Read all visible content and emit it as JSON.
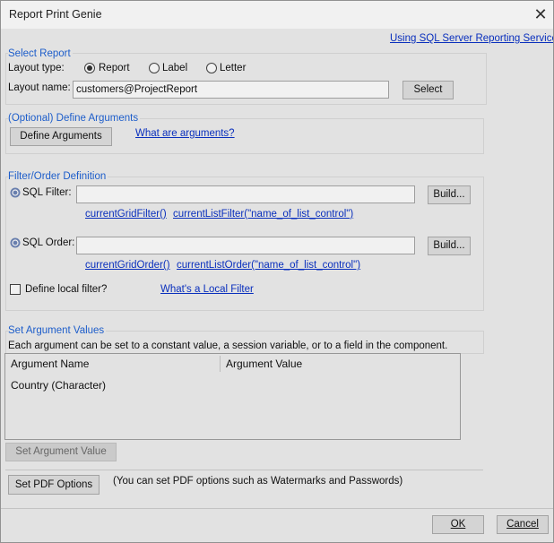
{
  "window": {
    "title": "Report Print Genie"
  },
  "header_link": "Using SQL Server Reporting Services",
  "select_report": {
    "title": "Select Report",
    "layout_type_label": "Layout type:",
    "layout_options": [
      {
        "label": "Report",
        "selected": true
      },
      {
        "label": "Label",
        "selected": false
      },
      {
        "label": "Letter",
        "selected": false
      }
    ],
    "layout_name_label": "Layout name:",
    "layout_name_value": "customers@ProjectReport",
    "select_button": "Select"
  },
  "define_args": {
    "title": "(Optional) Define Arguments",
    "button": "Define Arguments",
    "help_link": "What are arguments?"
  },
  "filter_order": {
    "title": "Filter/Order Definition",
    "sql_filter_label": "SQL Filter:",
    "sql_filter_value": "",
    "build_label": "Build...",
    "filter_links": [
      "currentGridFilter()",
      "currentListFilter(\"name_of_list_control\")"
    ],
    "sql_order_label": "SQL Order:",
    "sql_order_value": "",
    "order_links": [
      "currentGridOrder()",
      "currentListOrder(\"name_of_list_control\")"
    ],
    "local_filter_label": "Define local filter?",
    "local_filter_checked": false,
    "local_filter_link": "What's a Local Filter"
  },
  "arg_values": {
    "title": "Set Argument Values",
    "description": "Each argument can be set to a constant value, a session variable, or to a field in the component.",
    "columns": [
      "Argument Name",
      "Argument Value"
    ],
    "rows": [
      {
        "name": "Country (Character)",
        "value": ""
      }
    ],
    "set_button": "Set Argument Value"
  },
  "pdf": {
    "button": "Set PDF Options",
    "note": "(You can set PDF options such as Watermarks and Passwords)"
  },
  "footer": {
    "ok": "OK",
    "cancel": "Cancel"
  },
  "colors": {
    "group_title": "#1f63d6",
    "link": "#0a32c8"
  }
}
